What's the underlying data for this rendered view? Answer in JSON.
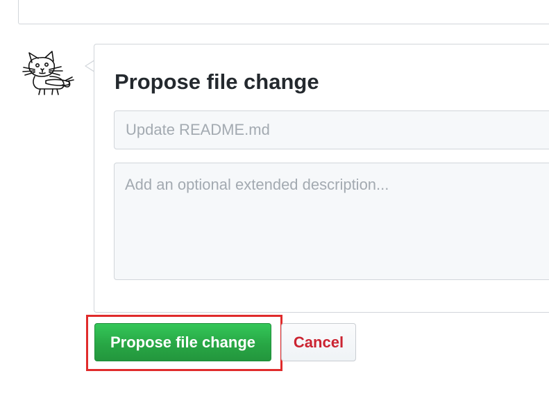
{
  "commit_form": {
    "title": "Propose file change",
    "summary_placeholder": "Update README.md",
    "summary_value": "",
    "description_placeholder": "Add an optional extended description...",
    "description_value": ""
  },
  "actions": {
    "propose_label": "Propose file change",
    "cancel_label": "Cancel"
  },
  "avatar": {
    "icon": "cat-sketch-avatar"
  },
  "colors": {
    "primary_button": "#28a745",
    "cancel_text": "#cb2431",
    "highlight": "#e02b2b",
    "input_background": "#f6f8fa",
    "border": "#d1d5da"
  }
}
